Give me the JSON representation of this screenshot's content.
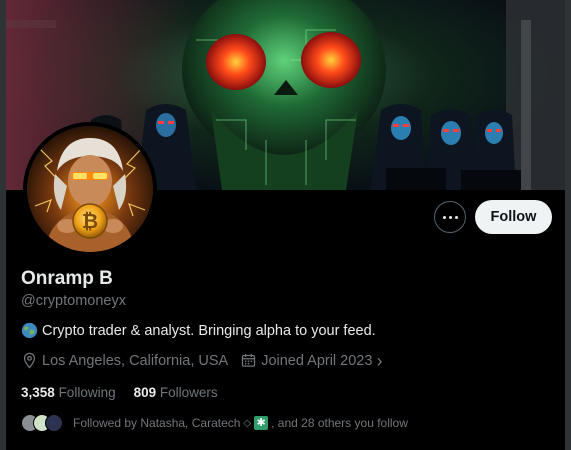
{
  "profile": {
    "name": "Onramp B",
    "handle": "@cryptomoneyx",
    "bio_emoji": "globe-emoji",
    "bio": "Crypto trader & analyst. Bringing alpha to your feed.",
    "location": "Los Angeles, California, USA",
    "joined": "Joined April 2023",
    "joined_chevron": "›"
  },
  "stats": {
    "following_count": "3,358",
    "following_label": "Following",
    "followers_count": "809",
    "followers_label": "Followers"
  },
  "actions": {
    "follow_label": "Follow",
    "more_icon": "more-horizontal-icon"
  },
  "followed_by": {
    "prefix": "Followed by Natasha, Caratech",
    "diamond": "◇",
    "asterisk": "✱",
    "suffix": ", and 28 others you follow"
  },
  "colors": {
    "background": "#000000",
    "text": "#e7e9ea",
    "muted": "#71767b",
    "follow_button_bg": "#eff3f4",
    "follow_button_text": "#0f1419"
  }
}
